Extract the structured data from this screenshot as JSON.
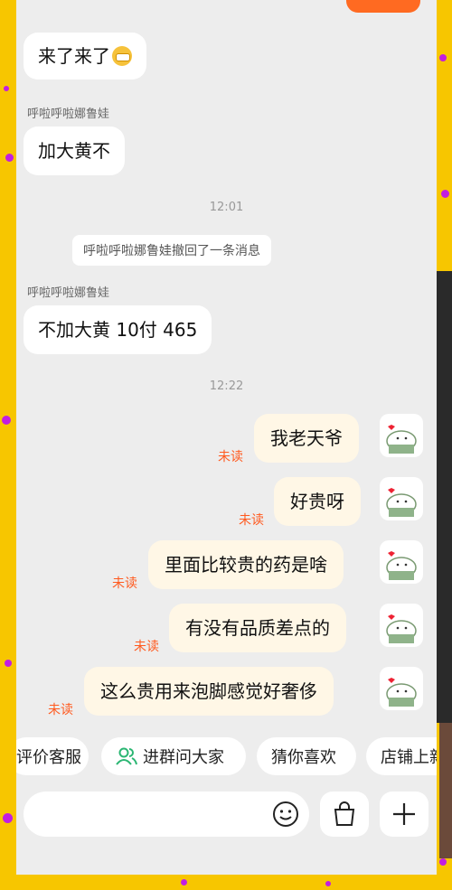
{
  "status_bar": {
    "left_text": "",
    "pill_color": "#ff6a21"
  },
  "messages": [
    {
      "sender": "",
      "text": "来了来了",
      "emoji": "smile-mask-emoji"
    },
    {
      "sender": "呼啦呼啦娜鲁娃",
      "text": "加大黄不"
    }
  ],
  "time_1": "12:01",
  "recall_notice": "呼啦呼啦娜鲁娃撤回了一条消息",
  "message_3": {
    "sender": "呼啦呼啦娜鲁娃",
    "text": "不加大黄 10付 465"
  },
  "time_2": "12:22",
  "my_messages": [
    {
      "text": "我老天爷",
      "status": "未读"
    },
    {
      "text": "好贵呀",
      "status": "未读"
    },
    {
      "text": "里面比较贵的药是啥",
      "status": "未读"
    },
    {
      "text": "有没有品质差点的",
      "status": "未读"
    },
    {
      "text": "这么贵用来泡脚感觉好奢侈",
      "status": "未读"
    }
  ],
  "quick_actions": [
    {
      "label": "评价客服"
    },
    {
      "label": "进群问大家",
      "icon": "group-icon"
    },
    {
      "label": "猜你喜欢"
    },
    {
      "label": "店铺上新"
    }
  ],
  "input_bar": {
    "placeholder": "",
    "icons": [
      "emoji-face-icon",
      "shopping-bag-icon",
      "plus-icon"
    ]
  },
  "colors": {
    "unread": "#ff5a1f",
    "my_bubble": "#fff7e6",
    "frame_yellow": "#f7c600",
    "group_icon_green": "#2bb673"
  }
}
